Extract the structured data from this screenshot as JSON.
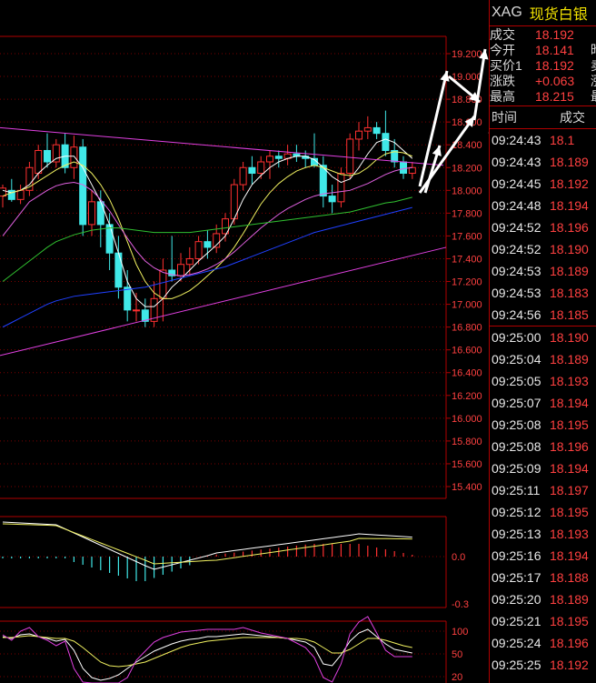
{
  "symbol": {
    "code": "XAG",
    "name": "现货白银"
  },
  "quote": [
    {
      "label": "成交",
      "value": "18.192",
      "extra": ""
    },
    {
      "label": "今开",
      "value": "18.141",
      "extra": "昨"
    },
    {
      "label": "买价1",
      "value": "18.192",
      "extra": "卖"
    },
    {
      "label": "涨跌",
      "value": "+0.063",
      "extra": "涨"
    },
    {
      "label": "最高",
      "value": "18.215",
      "extra": "最"
    }
  ],
  "ticks_header": {
    "time": "时间",
    "volume": "成交"
  },
  "ticks": [
    {
      "time": "09:24:43",
      "price": "18.1"
    },
    {
      "time": "09:24:43",
      "price": "18.189"
    },
    {
      "time": "09:24:45",
      "price": "18.192"
    },
    {
      "time": "09:24:48",
      "price": "18.194"
    },
    {
      "time": "09:24:52",
      "price": "18.196"
    },
    {
      "time": "09:24:52",
      "price": "18.190"
    },
    {
      "time": "09:24:53",
      "price": "18.189"
    },
    {
      "time": "09:24:53",
      "price": "18.183"
    },
    {
      "time": "09:24:56",
      "price": "18.185"
    },
    {
      "time": "09:25:00",
      "price": "18.190"
    },
    {
      "time": "09:25:04",
      "price": "18.189"
    },
    {
      "time": "09:25:05",
      "price": "18.193"
    },
    {
      "time": "09:25:07",
      "price": "18.194"
    },
    {
      "time": "09:25:08",
      "price": "18.195"
    },
    {
      "time": "09:25:08",
      "price": "18.196"
    },
    {
      "time": "09:25:09",
      "price": "18.194"
    },
    {
      "time": "09:25:11",
      "price": "18.197"
    },
    {
      "time": "09:25:12",
      "price": "18.195"
    },
    {
      "time": "09:25:13",
      "price": "18.193"
    },
    {
      "time": "09:25:16",
      "price": "18.194"
    },
    {
      "time": "09:25:17",
      "price": "18.188"
    },
    {
      "time": "09:25:20",
      "price": "18.189"
    },
    {
      "time": "09:25:21",
      "price": "18.195"
    },
    {
      "time": "09:25:24",
      "price": "18.196"
    },
    {
      "time": "09:25:25",
      "price": "18.192"
    }
  ],
  "colors": {
    "up": "#ff3030",
    "down": "#40e8e8",
    "axis": "#b00000",
    "grid": "#7a0000",
    "label": "#ff4040"
  },
  "chart_data": [
    {
      "type": "candlestick",
      "yticks": [
        "19.200",
        "19.000",
        "18.800",
        "18.600",
        "18.400",
        "18.200",
        "18.000",
        "17.800",
        "17.600",
        "17.400",
        "17.200",
        "17.000",
        "16.800",
        "16.600",
        "16.400",
        "16.200",
        "16.000",
        "15.800",
        "15.600",
        "15.400"
      ],
      "ylim": [
        15.4,
        19.2
      ],
      "candles": [
        {
          "o": 17.95,
          "h": 18.05,
          "l": 17.85,
          "c": 18.02
        },
        {
          "o": 18.0,
          "h": 18.1,
          "l": 17.9,
          "c": 17.92
        },
        {
          "o": 17.92,
          "h": 18.05,
          "l": 17.88,
          "c": 18.0
        },
        {
          "o": 18.0,
          "h": 18.25,
          "l": 17.95,
          "c": 18.2
        },
        {
          "o": 18.15,
          "h": 18.4,
          "l": 18.1,
          "c": 18.35
        },
        {
          "o": 18.35,
          "h": 18.5,
          "l": 18.2,
          "c": 18.25
        },
        {
          "o": 18.25,
          "h": 18.45,
          "l": 18.2,
          "c": 18.4
        },
        {
          "o": 18.4,
          "h": 18.5,
          "l": 18.15,
          "c": 18.2
        },
        {
          "o": 18.2,
          "h": 18.48,
          "l": 18.1,
          "c": 18.38
        },
        {
          "o": 18.38,
          "h": 18.45,
          "l": 17.6,
          "c": 17.7
        },
        {
          "o": 17.7,
          "h": 18.0,
          "l": 17.6,
          "c": 17.9
        },
        {
          "o": 17.9,
          "h": 18.0,
          "l": 17.5,
          "c": 17.7
        },
        {
          "o": 17.7,
          "h": 17.8,
          "l": 17.3,
          "c": 17.45
        },
        {
          "o": 17.45,
          "h": 17.6,
          "l": 17.05,
          "c": 17.15
        },
        {
          "o": 17.15,
          "h": 17.3,
          "l": 16.85,
          "c": 16.95
        },
        {
          "o": 16.95,
          "h": 17.1,
          "l": 16.85,
          "c": 16.95
        },
        {
          "o": 16.95,
          "h": 17.05,
          "l": 16.8,
          "c": 16.85
        },
        {
          "o": 16.85,
          "h": 17.2,
          "l": 16.8,
          "c": 17.05
        },
        {
          "o": 17.05,
          "h": 17.4,
          "l": 16.85,
          "c": 17.3
        },
        {
          "o": 17.3,
          "h": 17.6,
          "l": 17.2,
          "c": 17.25
        },
        {
          "o": 17.25,
          "h": 17.45,
          "l": 17.2,
          "c": 17.35
        },
        {
          "o": 17.35,
          "h": 17.5,
          "l": 17.25,
          "c": 17.4
        },
        {
          "o": 17.4,
          "h": 17.6,
          "l": 17.35,
          "c": 17.55
        },
        {
          "o": 17.55,
          "h": 17.65,
          "l": 17.4,
          "c": 17.5
        },
        {
          "o": 17.5,
          "h": 17.7,
          "l": 17.45,
          "c": 17.62
        },
        {
          "o": 17.62,
          "h": 17.8,
          "l": 17.55,
          "c": 17.75
        },
        {
          "o": 17.75,
          "h": 18.1,
          "l": 17.7,
          "c": 18.05
        },
        {
          "o": 18.05,
          "h": 18.25,
          "l": 18.0,
          "c": 18.2
        },
        {
          "o": 18.2,
          "h": 18.3,
          "l": 18.05,
          "c": 18.15
        },
        {
          "o": 18.15,
          "h": 18.3,
          "l": 18.1,
          "c": 18.25
        },
        {
          "o": 18.25,
          "h": 18.35,
          "l": 18.1,
          "c": 18.3
        },
        {
          "o": 18.3,
          "h": 18.35,
          "l": 18.2,
          "c": 18.28
        },
        {
          "o": 18.28,
          "h": 18.4,
          "l": 18.22,
          "c": 18.32
        },
        {
          "o": 18.32,
          "h": 18.4,
          "l": 18.25,
          "c": 18.3
        },
        {
          "o": 18.3,
          "h": 18.35,
          "l": 18.2,
          "c": 18.28
        },
        {
          "o": 18.28,
          "h": 18.5,
          "l": 18.2,
          "c": 18.22
        },
        {
          "o": 18.22,
          "h": 18.3,
          "l": 17.85,
          "c": 17.95
        },
        {
          "o": 17.95,
          "h": 18.05,
          "l": 17.8,
          "c": 17.9
        },
        {
          "o": 17.9,
          "h": 18.2,
          "l": 17.85,
          "c": 18.15
        },
        {
          "o": 18.15,
          "h": 18.5,
          "l": 18.1,
          "c": 18.45
        },
        {
          "o": 18.45,
          "h": 18.6,
          "l": 18.35,
          "c": 18.52
        },
        {
          "o": 18.52,
          "h": 18.65,
          "l": 18.45,
          "c": 18.55
        },
        {
          "o": 18.55,
          "h": 18.6,
          "l": 18.45,
          "c": 18.5
        },
        {
          "o": 18.5,
          "h": 18.7,
          "l": 18.3,
          "c": 18.35
        },
        {
          "o": 18.35,
          "h": 18.45,
          "l": 18.2,
          "c": 18.25
        },
        {
          "o": 18.25,
          "h": 18.3,
          "l": 18.1,
          "c": 18.15
        },
        {
          "o": 18.15,
          "h": 18.25,
          "l": 18.1,
          "c": 18.2
        }
      ],
      "ma": [
        {
          "color": "#ffffff",
          "values": [
            18.0,
            17.98,
            18.0,
            18.05,
            18.15,
            18.22,
            18.28,
            18.3,
            18.3,
            18.2,
            18.05,
            17.9,
            17.7,
            17.45,
            17.2,
            17.05,
            16.98,
            16.98,
            17.05,
            17.15,
            17.22,
            17.3,
            17.38,
            17.45,
            17.52,
            17.6,
            17.75,
            17.92,
            18.05,
            18.13,
            18.2,
            18.25,
            18.28,
            18.3,
            18.3,
            18.27,
            18.2,
            18.12,
            18.07,
            18.1,
            18.2,
            18.32,
            18.42,
            18.45,
            18.42,
            18.35,
            18.28
          ]
        },
        {
          "color": "#f0f060",
          "values": [
            17.95,
            17.98,
            18.0,
            18.03,
            18.08,
            18.13,
            18.18,
            18.22,
            18.25,
            18.22,
            18.15,
            18.05,
            17.92,
            17.75,
            17.55,
            17.35,
            17.2,
            17.1,
            17.05,
            17.05,
            17.08,
            17.12,
            17.18,
            17.25,
            17.32,
            17.4,
            17.5,
            17.62,
            17.75,
            17.88,
            17.98,
            18.06,
            18.12,
            18.17,
            18.2,
            18.22,
            18.2,
            18.17,
            18.14,
            18.13,
            18.15,
            18.2,
            18.27,
            18.32,
            18.34,
            18.33,
            18.3
          ]
        },
        {
          "color": "#e060e0",
          "values": [
            17.6,
            17.7,
            17.8,
            17.9,
            17.95,
            18.0,
            18.04,
            18.06,
            18.07,
            18.05,
            18.0,
            17.92,
            17.82,
            17.7,
            17.58,
            17.47,
            17.38,
            17.32,
            17.28,
            17.26,
            17.25,
            17.26,
            17.28,
            17.31,
            17.35,
            17.4,
            17.46,
            17.53,
            17.6,
            17.67,
            17.73,
            17.79,
            17.84,
            17.88,
            17.92,
            17.95,
            17.97,
            17.98,
            17.99,
            18.0,
            18.03,
            18.06,
            18.1,
            18.14,
            18.17,
            18.19,
            18.2
          ]
        },
        {
          "color": "#30c030",
          "values": [
            17.2,
            17.26,
            17.32,
            17.38,
            17.44,
            17.5,
            17.55,
            17.58,
            17.61,
            17.63,
            17.65,
            17.66,
            17.67,
            17.67,
            17.66,
            17.65,
            17.64,
            17.63,
            17.63,
            17.63,
            17.63,
            17.63,
            17.64,
            17.65,
            17.66,
            17.67,
            17.68,
            17.69,
            17.7,
            17.71,
            17.72,
            17.73,
            17.74,
            17.75,
            17.76,
            17.77,
            17.78,
            17.79,
            17.8,
            17.81,
            17.83,
            17.85,
            17.87,
            17.89,
            17.9,
            17.92,
            17.94
          ]
        },
        {
          "color": "#2040ff",
          "values": [
            16.8,
            16.84,
            16.88,
            16.92,
            16.96,
            17.0,
            17.03,
            17.05,
            17.07,
            17.08,
            17.09,
            17.1,
            17.11,
            17.12,
            17.13,
            17.14,
            17.15,
            17.17,
            17.19,
            17.21,
            17.23,
            17.25,
            17.27,
            17.29,
            17.31,
            17.33,
            17.36,
            17.39,
            17.42,
            17.45,
            17.48,
            17.51,
            17.54,
            17.57,
            17.6,
            17.63,
            17.65,
            17.67,
            17.69,
            17.71,
            17.73,
            17.75,
            17.77,
            17.79,
            17.81,
            17.83,
            17.85
          ]
        }
      ]
    },
    {
      "type": "macd",
      "yticks": [
        "0.0",
        "-0.3"
      ]
    },
    {
      "type": "kdj",
      "yticks": [
        "100",
        "50",
        "20"
      ]
    }
  ]
}
